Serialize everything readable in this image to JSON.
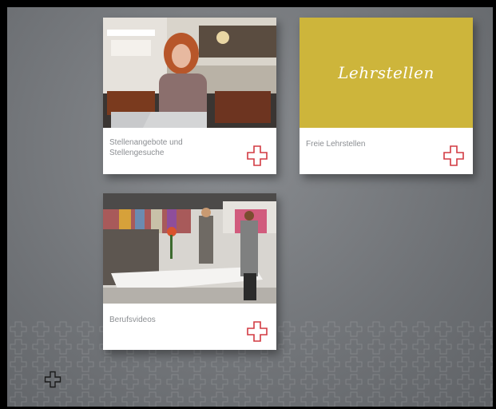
{
  "tiles": [
    {
      "caption": "Stellenangebote und Stellengesuche",
      "icon": "swiss-cross-outline-icon"
    },
    {
      "caption": "Freie Lehrstellen",
      "banner_title": "Lehrstellen",
      "banner_color": "#cdb53b",
      "icon": "swiss-cross-outline-icon"
    },
    {
      "caption": "Berufsvideos",
      "icon": "swiss-cross-outline-icon"
    }
  ],
  "colors": {
    "accent": "#d23a42",
    "background": "#6c6f73"
  }
}
